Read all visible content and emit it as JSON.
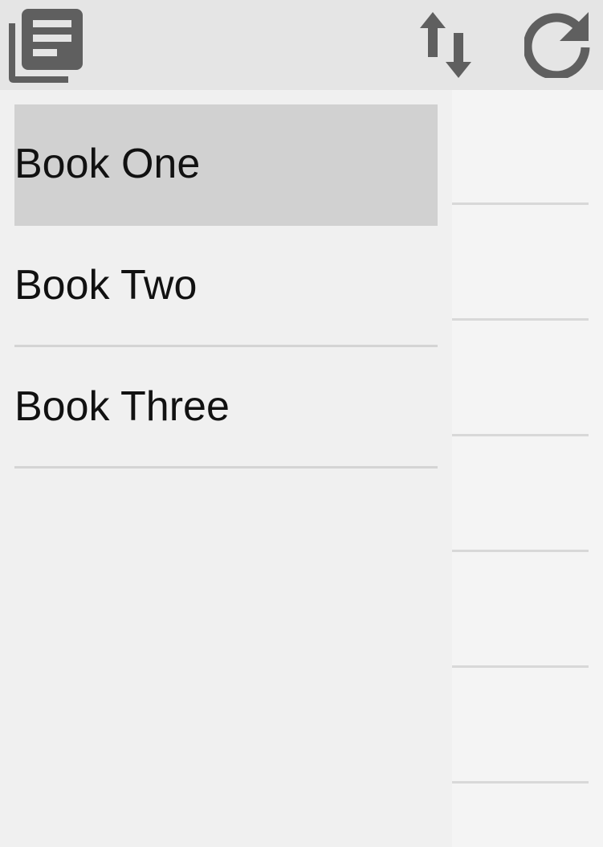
{
  "toolbar": {
    "library_icon": "library-books-icon",
    "sort_icon": "swap-vertical-icon",
    "refresh_icon": "refresh-icon"
  },
  "drawer": {
    "books": [
      {
        "label": "Book One",
        "selected": true
      },
      {
        "label": "Book Two",
        "selected": false
      },
      {
        "label": "Book Three",
        "selected": false
      }
    ]
  },
  "colors": {
    "toolbar_bg": "#e5e5e5",
    "icon": "#5f5f5f",
    "drawer_bg": "#f0f0f0",
    "selected_bg": "#d1d1d1",
    "divider": "#d4d4d4"
  }
}
